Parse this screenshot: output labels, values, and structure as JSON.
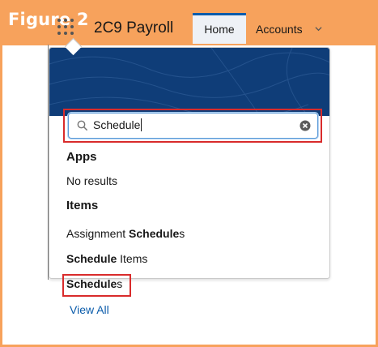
{
  "figure": {
    "title": "Figure 2"
  },
  "nav": {
    "app_name": "2C9 Payroll",
    "tabs": [
      {
        "label": "Home",
        "active": true
      },
      {
        "label": "Accounts"
      }
    ]
  },
  "search": {
    "value": "Schedule"
  },
  "results": {
    "apps_heading": "Apps",
    "apps_empty": "No results",
    "items_heading": "Items",
    "items": [
      {
        "prefix": "Assignment ",
        "match": "Schedule",
        "suffix": "s"
      },
      {
        "prefix": "",
        "match": "Schedule",
        "suffix": " Items"
      },
      {
        "prefix": "",
        "match": "Schedule",
        "suffix": "s"
      }
    ],
    "view_all": "View All"
  },
  "colors": {
    "figure_header": "#f7a25c",
    "highlight_box": "#d92b2b",
    "link": "#0b5cab",
    "banner": "#0f3d78"
  }
}
